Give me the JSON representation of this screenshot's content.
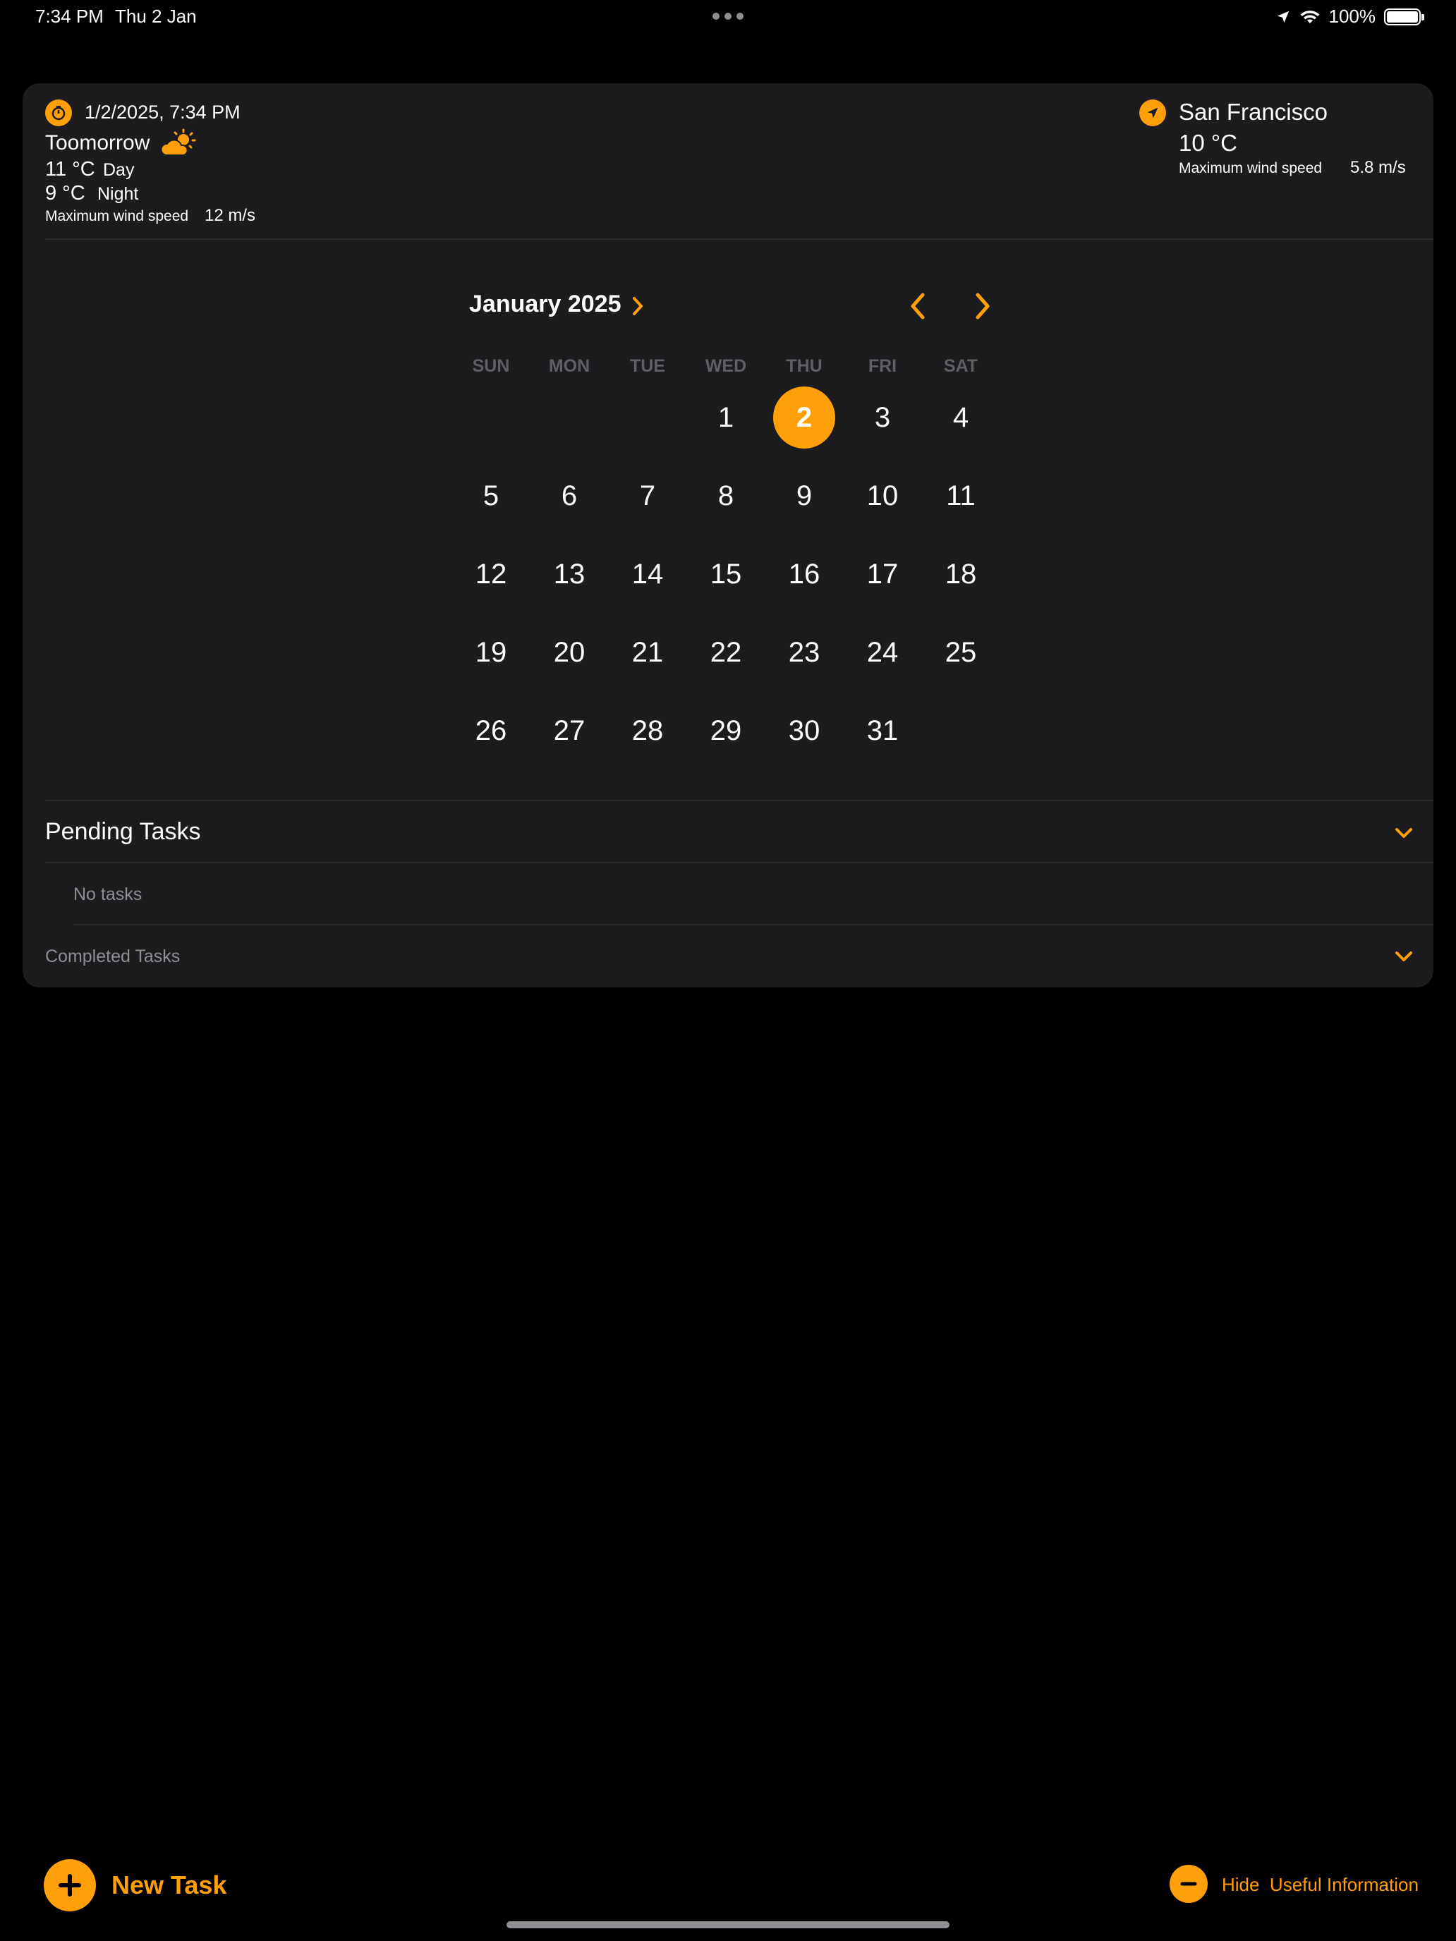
{
  "status_bar": {
    "time": "7:34 PM",
    "date": "Thu 2 Jan",
    "battery": "100%"
  },
  "weather": {
    "datetime": "1/2/2025, 7:34 PM",
    "forecast_label": "Toomorrow",
    "day_temp": "11 °C",
    "day_label": "Day",
    "night_temp": "9 °C",
    "night_label": "Night",
    "wind_label": "Maximum wind speed",
    "wind_value": "12 m/s",
    "forecast_icon": "cloud-sun-icon",
    "timer_icon": "timer-icon"
  },
  "location": {
    "city": "San Francisco",
    "temp": "10 °C",
    "wind_label": "Maximum wind speed",
    "wind_value": "5.8 m/s",
    "icon": "location-arrow-icon"
  },
  "calendar": {
    "month_title": "January 2025",
    "weekdays": [
      "SUN",
      "MON",
      "TUE",
      "WED",
      "THU",
      "FRI",
      "SAT"
    ],
    "selected_day": "2",
    "first_weekday_index": 3,
    "days": [
      "1",
      "2",
      "3",
      "4",
      "5",
      "6",
      "7",
      "8",
      "9",
      "10",
      "11",
      "12",
      "13",
      "14",
      "15",
      "16",
      "17",
      "18",
      "19",
      "20",
      "21",
      "22",
      "23",
      "24",
      "25",
      "26",
      "27",
      "28",
      "29",
      "30",
      "31"
    ]
  },
  "tasks": {
    "pending_title": "Pending Tasks",
    "no_tasks": "No tasks",
    "completed_title": "Completed Tasks"
  },
  "toolbar": {
    "new_task": "New Task",
    "hide_info": "Hide  Useful Information"
  },
  "colors": {
    "accent": "#ff9f0a",
    "card_bg": "#1c1c1e",
    "page_bg": "#000000",
    "muted": "#8e8e93"
  }
}
